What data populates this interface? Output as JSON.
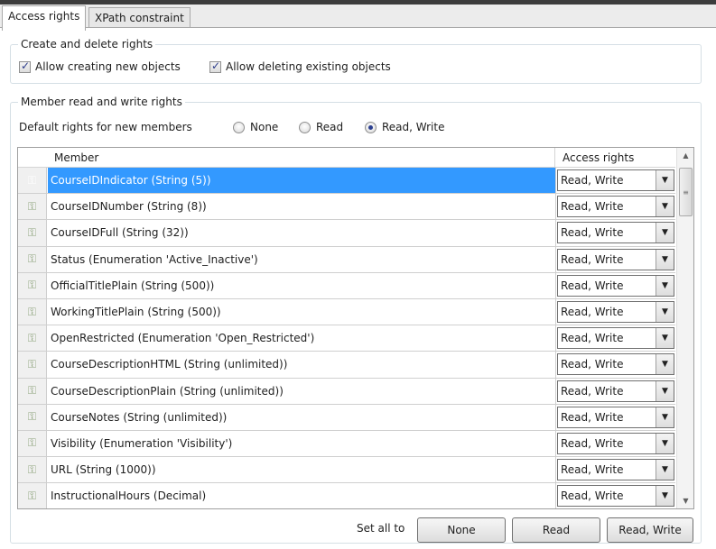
{
  "tabs": [
    {
      "label": "Access rights",
      "active": true
    },
    {
      "label": "XPath constraint",
      "active": false
    }
  ],
  "create_delete": {
    "legend": "Create and delete rights",
    "allow_create": {
      "label": "Allow creating new objects",
      "checked": true
    },
    "allow_delete": {
      "label": "Allow deleting existing objects",
      "checked": true
    }
  },
  "member_rights": {
    "legend": "Member read and write rights",
    "default_label": "Default rights for new members",
    "options": [
      {
        "label": "None",
        "selected": false
      },
      {
        "label": "Read",
        "selected": false
      },
      {
        "label": "Read, Write",
        "selected": true
      }
    ]
  },
  "grid": {
    "columns": {
      "member": "Member",
      "access": "Access rights"
    },
    "rows": [
      {
        "member": "CourseIDIndicator (String (5))",
        "access": "Read, Write",
        "selected": true
      },
      {
        "member": "CourseIDNumber (String (8))",
        "access": "Read, Write"
      },
      {
        "member": "CourseIDFull (String (32))",
        "access": "Read, Write"
      },
      {
        "member": "Status (Enumeration 'Active_Inactive')",
        "access": "Read, Write"
      },
      {
        "member": "OfficialTitlePlain (String (500))",
        "access": "Read, Write"
      },
      {
        "member": "WorkingTitlePlain (String (500))",
        "access": "Read, Write"
      },
      {
        "member": "OpenRestricted (Enumeration 'Open_Restricted')",
        "access": "Read, Write"
      },
      {
        "member": "CourseDescriptionHTML (String (unlimited))",
        "access": "Read, Write"
      },
      {
        "member": "CourseDescriptionPlain (String (unlimited))",
        "access": "Read, Write"
      },
      {
        "member": "CourseNotes (String (unlimited))",
        "access": "Read, Write"
      },
      {
        "member": "Visibility (Enumeration 'Visibility')",
        "access": "Read, Write"
      },
      {
        "member": "URL (String (1000))",
        "access": "Read, Write"
      },
      {
        "member": "InstructionalHours (Decimal)",
        "access": "Read, Write"
      }
    ],
    "row_icon": "key-icon"
  },
  "set_all": {
    "label": "Set all to",
    "buttons": [
      "None",
      "Read",
      "Read, Write"
    ]
  },
  "colors": {
    "selection": "#3399ff",
    "radio_dot": "#2b3f8f",
    "check": "#2a3a8a"
  }
}
